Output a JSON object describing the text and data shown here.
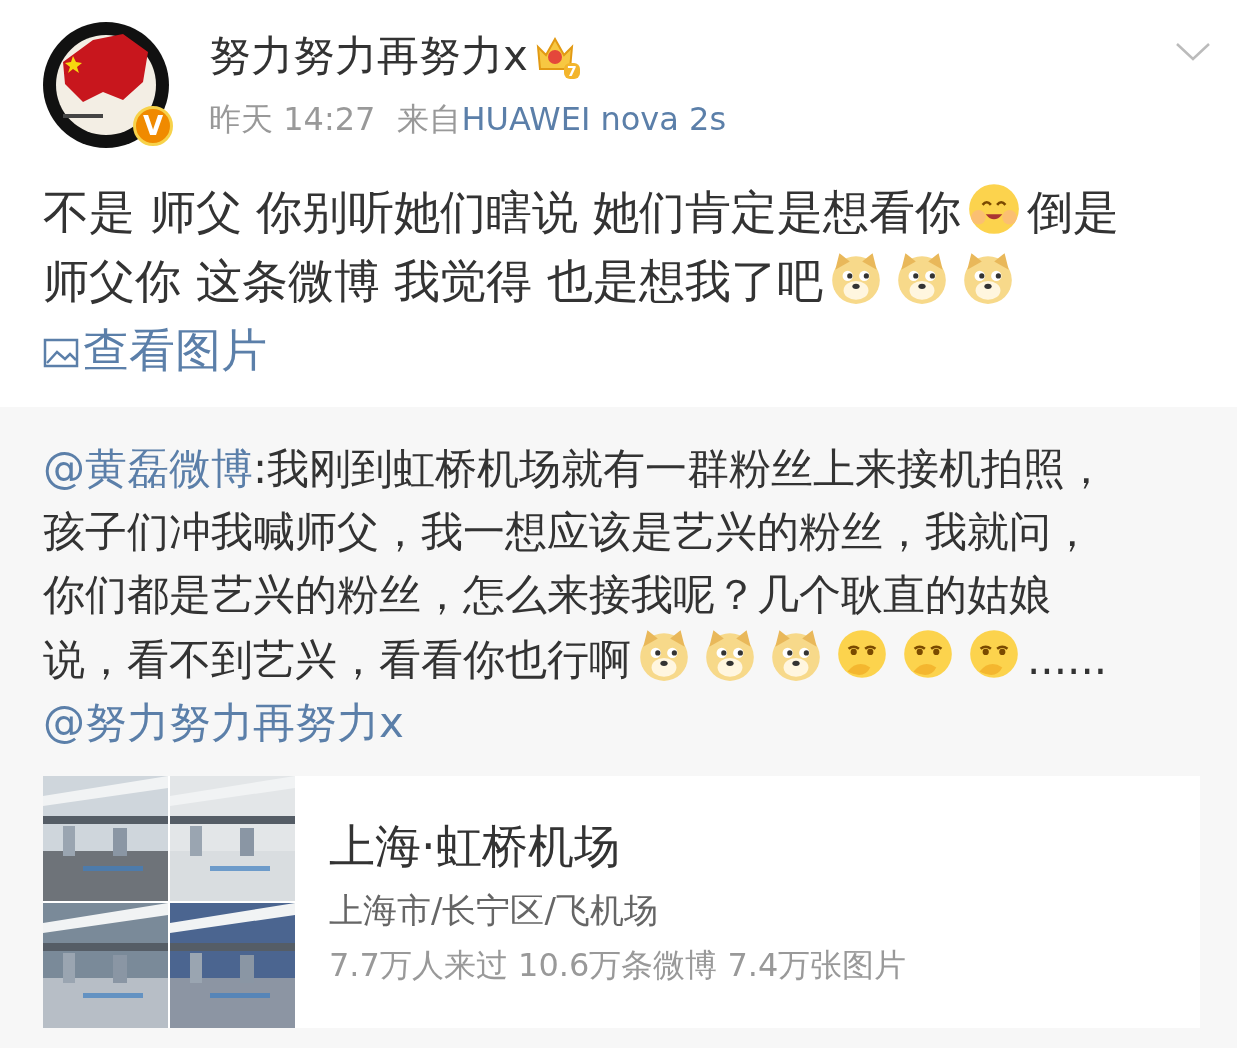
{
  "post": {
    "author": "努力努力再努力x",
    "vip_level": "7",
    "verified_badge": "V",
    "time": "昨天 14:27",
    "source_prefix": "来自",
    "source": "HUAWEI nova 2s",
    "body": [
      {
        "kind": "text",
        "text": "不是 师父 你别听她们瞎说 她们肯定是想看你"
      },
      {
        "kind": "blush"
      },
      {
        "kind": "text",
        "text": "倒是"
      },
      {
        "kind": "break"
      },
      {
        "kind": "text",
        "text": "师父你 这条微博 我觉得 也是想我了吧"
      },
      {
        "kind": "doge"
      },
      {
        "kind": "doge"
      },
      {
        "kind": "doge"
      },
      {
        "kind": "break"
      },
      {
        "kind": "photo_link",
        "text": "查看图片"
      }
    ]
  },
  "repost": {
    "body": [
      {
        "kind": "mention",
        "text": "@黄磊微博"
      },
      {
        "kind": "text",
        "text": ":我刚到虹桥机场就有一群粉丝上来接机拍照，"
      },
      {
        "kind": "break"
      },
      {
        "kind": "text",
        "text": "孩子们冲我喊师父，我一想应该是艺兴的粉丝，我就问，"
      },
      {
        "kind": "break"
      },
      {
        "kind": "text",
        "text": "你们都是艺兴的粉丝，怎么来接我呢？几个耿直的姑娘"
      },
      {
        "kind": "break"
      },
      {
        "kind": "text",
        "text": "说，看不到艺兴，看看你也行啊"
      },
      {
        "kind": "doge"
      },
      {
        "kind": "doge"
      },
      {
        "kind": "doge"
      },
      {
        "kind": "cover"
      },
      {
        "kind": "cover"
      },
      {
        "kind": "cover"
      },
      {
        "kind": "text",
        "text": "......"
      },
      {
        "kind": "break"
      },
      {
        "kind": "mention",
        "text": "@努力努力再努力x"
      }
    ],
    "place": {
      "title": "上海·虹桥机场",
      "address": "上海市/长宁区/飞机场",
      "stats": "7.7万人来过 10.6万条微博 7.4万张图片"
    }
  }
}
